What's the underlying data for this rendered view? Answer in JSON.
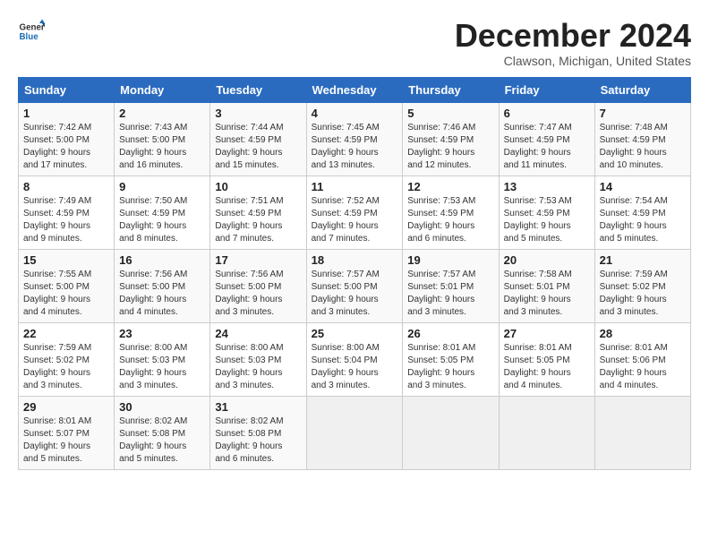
{
  "logo": {
    "line1": "General",
    "line2": "Blue"
  },
  "title": "December 2024",
  "location": "Clawson, Michigan, United States",
  "headers": [
    "Sunday",
    "Monday",
    "Tuesday",
    "Wednesday",
    "Thursday",
    "Friday",
    "Saturday"
  ],
  "weeks": [
    [
      {
        "day": "1",
        "info": "Sunrise: 7:42 AM\nSunset: 5:00 PM\nDaylight: 9 hours\nand 17 minutes."
      },
      {
        "day": "2",
        "info": "Sunrise: 7:43 AM\nSunset: 5:00 PM\nDaylight: 9 hours\nand 16 minutes."
      },
      {
        "day": "3",
        "info": "Sunrise: 7:44 AM\nSunset: 4:59 PM\nDaylight: 9 hours\nand 15 minutes."
      },
      {
        "day": "4",
        "info": "Sunrise: 7:45 AM\nSunset: 4:59 PM\nDaylight: 9 hours\nand 13 minutes."
      },
      {
        "day": "5",
        "info": "Sunrise: 7:46 AM\nSunset: 4:59 PM\nDaylight: 9 hours\nand 12 minutes."
      },
      {
        "day": "6",
        "info": "Sunrise: 7:47 AM\nSunset: 4:59 PM\nDaylight: 9 hours\nand 11 minutes."
      },
      {
        "day": "7",
        "info": "Sunrise: 7:48 AM\nSunset: 4:59 PM\nDaylight: 9 hours\nand 10 minutes."
      }
    ],
    [
      {
        "day": "8",
        "info": "Sunrise: 7:49 AM\nSunset: 4:59 PM\nDaylight: 9 hours\nand 9 minutes."
      },
      {
        "day": "9",
        "info": "Sunrise: 7:50 AM\nSunset: 4:59 PM\nDaylight: 9 hours\nand 8 minutes."
      },
      {
        "day": "10",
        "info": "Sunrise: 7:51 AM\nSunset: 4:59 PM\nDaylight: 9 hours\nand 7 minutes."
      },
      {
        "day": "11",
        "info": "Sunrise: 7:52 AM\nSunset: 4:59 PM\nDaylight: 9 hours\nand 7 minutes."
      },
      {
        "day": "12",
        "info": "Sunrise: 7:53 AM\nSunset: 4:59 PM\nDaylight: 9 hours\nand 6 minutes."
      },
      {
        "day": "13",
        "info": "Sunrise: 7:53 AM\nSunset: 4:59 PM\nDaylight: 9 hours\nand 5 minutes."
      },
      {
        "day": "14",
        "info": "Sunrise: 7:54 AM\nSunset: 4:59 PM\nDaylight: 9 hours\nand 5 minutes."
      }
    ],
    [
      {
        "day": "15",
        "info": "Sunrise: 7:55 AM\nSunset: 5:00 PM\nDaylight: 9 hours\nand 4 minutes."
      },
      {
        "day": "16",
        "info": "Sunrise: 7:56 AM\nSunset: 5:00 PM\nDaylight: 9 hours\nand 4 minutes."
      },
      {
        "day": "17",
        "info": "Sunrise: 7:56 AM\nSunset: 5:00 PM\nDaylight: 9 hours\nand 3 minutes."
      },
      {
        "day": "18",
        "info": "Sunrise: 7:57 AM\nSunset: 5:00 PM\nDaylight: 9 hours\nand 3 minutes."
      },
      {
        "day": "19",
        "info": "Sunrise: 7:57 AM\nSunset: 5:01 PM\nDaylight: 9 hours\nand 3 minutes."
      },
      {
        "day": "20",
        "info": "Sunrise: 7:58 AM\nSunset: 5:01 PM\nDaylight: 9 hours\nand 3 minutes."
      },
      {
        "day": "21",
        "info": "Sunrise: 7:59 AM\nSunset: 5:02 PM\nDaylight: 9 hours\nand 3 minutes."
      }
    ],
    [
      {
        "day": "22",
        "info": "Sunrise: 7:59 AM\nSunset: 5:02 PM\nDaylight: 9 hours\nand 3 minutes."
      },
      {
        "day": "23",
        "info": "Sunrise: 8:00 AM\nSunset: 5:03 PM\nDaylight: 9 hours\nand 3 minutes."
      },
      {
        "day": "24",
        "info": "Sunrise: 8:00 AM\nSunset: 5:03 PM\nDaylight: 9 hours\nand 3 minutes."
      },
      {
        "day": "25",
        "info": "Sunrise: 8:00 AM\nSunset: 5:04 PM\nDaylight: 9 hours\nand 3 minutes."
      },
      {
        "day": "26",
        "info": "Sunrise: 8:01 AM\nSunset: 5:05 PM\nDaylight: 9 hours\nand 3 minutes."
      },
      {
        "day": "27",
        "info": "Sunrise: 8:01 AM\nSunset: 5:05 PM\nDaylight: 9 hours\nand 4 minutes."
      },
      {
        "day": "28",
        "info": "Sunrise: 8:01 AM\nSunset: 5:06 PM\nDaylight: 9 hours\nand 4 minutes."
      }
    ],
    [
      {
        "day": "29",
        "info": "Sunrise: 8:01 AM\nSunset: 5:07 PM\nDaylight: 9 hours\nand 5 minutes."
      },
      {
        "day": "30",
        "info": "Sunrise: 8:02 AM\nSunset: 5:08 PM\nDaylight: 9 hours\nand 5 minutes."
      },
      {
        "day": "31",
        "info": "Sunrise: 8:02 AM\nSunset: 5:08 PM\nDaylight: 9 hours\nand 6 minutes."
      },
      null,
      null,
      null,
      null
    ]
  ]
}
